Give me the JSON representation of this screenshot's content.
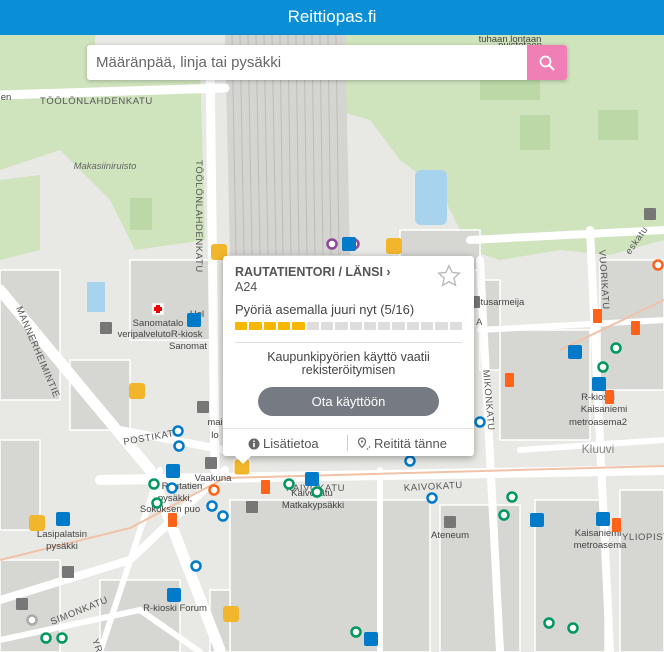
{
  "header": {
    "title": "Reittiopas.fi"
  },
  "search": {
    "placeholder": "Määränpää, linja tai pysäkki"
  },
  "map": {
    "street_labels": [
      "TÖÖLÖNLAHDENKATU",
      "TÖÖLÖNLAHDENKATU",
      "MANNERHEIMINTIE",
      "POSTIKATU",
      "KAIVOKATU",
      "SIMONKATU",
      "MIKONKATU",
      "VUORIKATU",
      "KAIVOKATU",
      "YLIOPIST",
      "YR",
      "eskatu",
      "A"
    ],
    "place_labels": [
      "Makasiiniruisto",
      "Sanomatalo",
      "veripalvelutoR-kiosk",
      "Sanomat",
      "Hel",
      "mai",
      "lo",
      "Vaakuna",
      "Kaivokatu",
      "Matkakypsäkki",
      "Rautatien",
      "pysäkki,",
      "Sokoksen puo",
      "Lasipalatsin",
      "pysäkki",
      "R-kioski Forum",
      "Ateneum",
      "Kluuvi",
      "R-kioski",
      "Kaisaniemi",
      "metroasema2",
      "Kaisaniemi",
      "metroasema",
      "stusarmeija",
      "en",
      "tuhaan lontaan",
      "puistotaen"
    ]
  },
  "popup": {
    "station_name": "RAUTATIENTORI / LÄNSI ›",
    "station_code": "A24",
    "bikes_text": "Pyöriä asemalla juuri nyt (5/16)",
    "bikes_available": 5,
    "bikes_capacity": 16,
    "note": "Kaupunkipyörien käyttö vaatii rekisteröitymisen",
    "cta_label": "Ota käyttöön",
    "info_label": "Lisätietoa",
    "route_label": "Reititä tänne",
    "fill_color": "#f7b600"
  },
  "colors": {
    "header": "#0a8fd6",
    "search_button": "#f07fb5",
    "bus": "#007ac9",
    "tram": "#00985f",
    "metro": "#ff6319",
    "train": "#8c4799",
    "citybike": "#f2b62d"
  },
  "icons": [
    "search-icon",
    "star-icon",
    "info-icon",
    "route-pin-icon",
    "bus-stop-icon",
    "tram-stop-icon",
    "metro-icon",
    "citybike-icon",
    "train-icon"
  ]
}
